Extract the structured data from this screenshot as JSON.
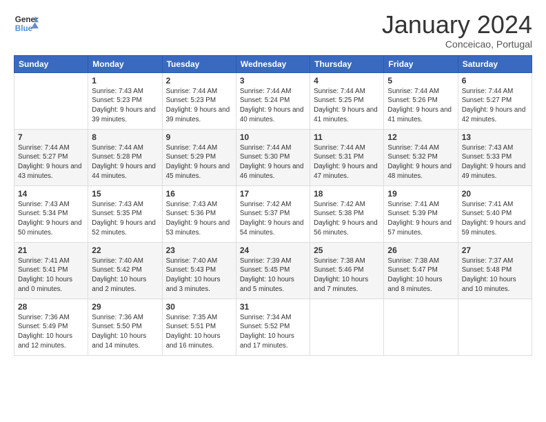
{
  "header": {
    "logo_line1": "General",
    "logo_line2": "Blue",
    "month": "January 2024",
    "location": "Conceicao, Portugal"
  },
  "days_of_week": [
    "Sunday",
    "Monday",
    "Tuesday",
    "Wednesday",
    "Thursday",
    "Friday",
    "Saturday"
  ],
  "weeks": [
    [
      {
        "day": null,
        "info": null
      },
      {
        "day": "1",
        "sunrise": "7:43 AM",
        "sunset": "5:23 PM",
        "daylight": "9 hours and 39 minutes."
      },
      {
        "day": "2",
        "sunrise": "7:44 AM",
        "sunset": "5:23 PM",
        "daylight": "9 hours and 39 minutes."
      },
      {
        "day": "3",
        "sunrise": "7:44 AM",
        "sunset": "5:24 PM",
        "daylight": "9 hours and 40 minutes."
      },
      {
        "day": "4",
        "sunrise": "7:44 AM",
        "sunset": "5:25 PM",
        "daylight": "9 hours and 41 minutes."
      },
      {
        "day": "5",
        "sunrise": "7:44 AM",
        "sunset": "5:26 PM",
        "daylight": "9 hours and 41 minutes."
      },
      {
        "day": "6",
        "sunrise": "7:44 AM",
        "sunset": "5:27 PM",
        "daylight": "9 hours and 42 minutes."
      }
    ],
    [
      {
        "day": "7",
        "sunrise": "7:44 AM",
        "sunset": "5:27 PM",
        "daylight": "9 hours and 43 minutes."
      },
      {
        "day": "8",
        "sunrise": "7:44 AM",
        "sunset": "5:28 PM",
        "daylight": "9 hours and 44 minutes."
      },
      {
        "day": "9",
        "sunrise": "7:44 AM",
        "sunset": "5:29 PM",
        "daylight": "9 hours and 45 minutes."
      },
      {
        "day": "10",
        "sunrise": "7:44 AM",
        "sunset": "5:30 PM",
        "daylight": "9 hours and 46 minutes."
      },
      {
        "day": "11",
        "sunrise": "7:44 AM",
        "sunset": "5:31 PM",
        "daylight": "9 hours and 47 minutes."
      },
      {
        "day": "12",
        "sunrise": "7:44 AM",
        "sunset": "5:32 PM",
        "daylight": "9 hours and 48 minutes."
      },
      {
        "day": "13",
        "sunrise": "7:43 AM",
        "sunset": "5:33 PM",
        "daylight": "9 hours and 49 minutes."
      }
    ],
    [
      {
        "day": "14",
        "sunrise": "7:43 AM",
        "sunset": "5:34 PM",
        "daylight": "9 hours and 50 minutes."
      },
      {
        "day": "15",
        "sunrise": "7:43 AM",
        "sunset": "5:35 PM",
        "daylight": "9 hours and 52 minutes."
      },
      {
        "day": "16",
        "sunrise": "7:43 AM",
        "sunset": "5:36 PM",
        "daylight": "9 hours and 53 minutes."
      },
      {
        "day": "17",
        "sunrise": "7:42 AM",
        "sunset": "5:37 PM",
        "daylight": "9 hours and 54 minutes."
      },
      {
        "day": "18",
        "sunrise": "7:42 AM",
        "sunset": "5:38 PM",
        "daylight": "9 hours and 56 minutes."
      },
      {
        "day": "19",
        "sunrise": "7:41 AM",
        "sunset": "5:39 PM",
        "daylight": "9 hours and 57 minutes."
      },
      {
        "day": "20",
        "sunrise": "7:41 AM",
        "sunset": "5:40 PM",
        "daylight": "9 hours and 59 minutes."
      }
    ],
    [
      {
        "day": "21",
        "sunrise": "7:41 AM",
        "sunset": "5:41 PM",
        "daylight": "10 hours and 0 minutes."
      },
      {
        "day": "22",
        "sunrise": "7:40 AM",
        "sunset": "5:42 PM",
        "daylight": "10 hours and 2 minutes."
      },
      {
        "day": "23",
        "sunrise": "7:40 AM",
        "sunset": "5:43 PM",
        "daylight": "10 hours and 3 minutes."
      },
      {
        "day": "24",
        "sunrise": "7:39 AM",
        "sunset": "5:45 PM",
        "daylight": "10 hours and 5 minutes."
      },
      {
        "day": "25",
        "sunrise": "7:38 AM",
        "sunset": "5:46 PM",
        "daylight": "10 hours and 7 minutes."
      },
      {
        "day": "26",
        "sunrise": "7:38 AM",
        "sunset": "5:47 PM",
        "daylight": "10 hours and 8 minutes."
      },
      {
        "day": "27",
        "sunrise": "7:37 AM",
        "sunset": "5:48 PM",
        "daylight": "10 hours and 10 minutes."
      }
    ],
    [
      {
        "day": "28",
        "sunrise": "7:36 AM",
        "sunset": "5:49 PM",
        "daylight": "10 hours and 12 minutes."
      },
      {
        "day": "29",
        "sunrise": "7:36 AM",
        "sunset": "5:50 PM",
        "daylight": "10 hours and 14 minutes."
      },
      {
        "day": "30",
        "sunrise": "7:35 AM",
        "sunset": "5:51 PM",
        "daylight": "10 hours and 16 minutes."
      },
      {
        "day": "31",
        "sunrise": "7:34 AM",
        "sunset": "5:52 PM",
        "daylight": "10 hours and 17 minutes."
      },
      {
        "day": null,
        "info": null
      },
      {
        "day": null,
        "info": null
      },
      {
        "day": null,
        "info": null
      }
    ]
  ],
  "labels": {
    "sunrise_prefix": "Sunrise: ",
    "sunset_prefix": "Sunset: ",
    "daylight_prefix": "Daylight: "
  }
}
